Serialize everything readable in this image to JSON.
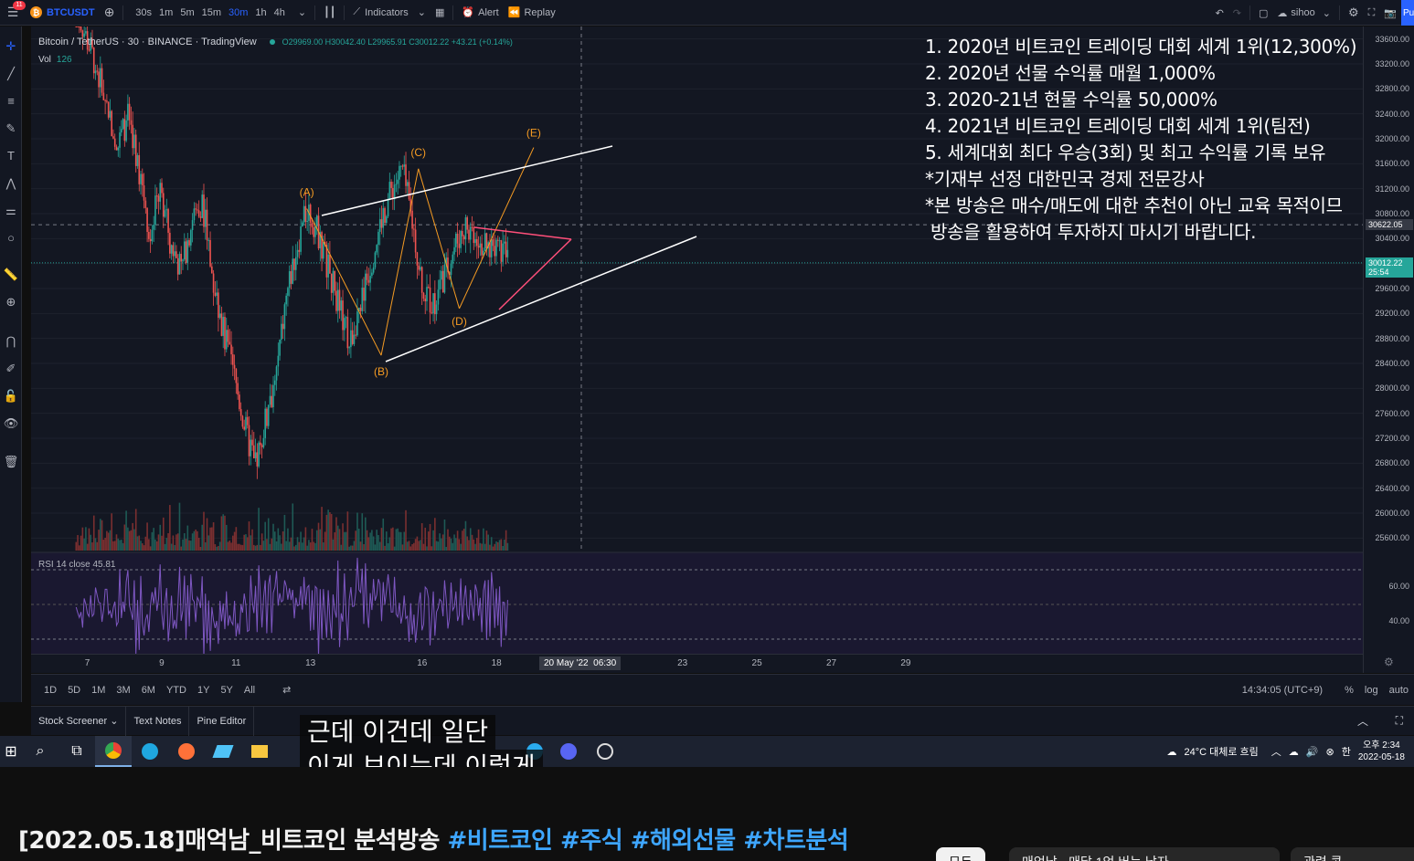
{
  "toolbar": {
    "notification_count": "11",
    "symbol": "BTCUSDT",
    "timeframes": [
      "30s",
      "1m",
      "5m",
      "15m",
      "30m",
      "1h",
      "4h"
    ],
    "active_timeframe": "30m",
    "indicators_label": "Indicators",
    "alert_label": "Alert",
    "replay_label": "Replay",
    "layout_name": "sihoo",
    "publish_label": "Pu"
  },
  "legend": {
    "title": "Bitcoin / TetherUS · 30 · BINANCE · TradingView",
    "ohlc": "O29969.00 H30042.40 L29965.91 C30012.22 +43.21 (+0.14%)",
    "vol_label": "Vol",
    "vol_value": "126",
    "rsi_label": "RSI 14 close 45.81"
  },
  "notes": [
    "1. 2020년 비트코인 트레이딩 대회 세계 1위(12,300%)",
    "2. 2020년 선물 수익률 매월 1,000%",
    "3. 2020-21년 현물 수익률 50,000%",
    "4. 2021년 비트코인 트레이딩 대회 세계 1위(팀전)",
    "5. 세계대회 최다 우승(3회) 및 최고 수익률 기록 보유",
    "*기재부 선정 대한민국 경제 전문강사",
    "*본 방송은 매수/매도에 대한 추천이 아닌 교육 목적이므",
    " 방송을 활용하여 투자하지 마시기 바랍니다."
  ],
  "chart_data": {
    "type": "line",
    "title": "Bitcoin / TetherUS · 30 · BINANCE",
    "ylim": [
      25400,
      33800
    ],
    "price_ticks": [
      33600,
      33200,
      32800,
      32400,
      32000,
      31600,
      31200,
      30800,
      30400,
      30000,
      29600,
      29200,
      28800,
      28400,
      28000,
      27600,
      27200,
      26800,
      26400,
      26000,
      25600
    ],
    "price_tick_labels": [
      "33600.00",
      "33200.00",
      "32800.00",
      "32400.00",
      "32000.00",
      "31600.00",
      "31200.00",
      "30800.00",
      "30400.00",
      "30000.00",
      "29600.00",
      "29200.00",
      "28800.00",
      "28400.00",
      "28000.00",
      "27600.00",
      "27200.00",
      "26800.00",
      "26400.00",
      "26000.00",
      "25600.00"
    ],
    "crosshair_price": "30622.05",
    "last_price": "30012.22",
    "countdown": "25:54",
    "wave_labels": [
      "(A)",
      "(B)",
      "(C)",
      "(D)",
      "(E)"
    ],
    "wave_points": [
      {
        "label": "(A)",
        "day": 12.9,
        "price": 30880
      },
      {
        "label": "(B)",
        "day": 14.9,
        "price": 28530
      },
      {
        "label": "(C)",
        "day": 15.9,
        "price": 31520
      },
      {
        "label": "(D)",
        "day": 17.0,
        "price": 29280
      },
      {
        "label": "(E)",
        "day": 19.0,
        "price": 31860
      }
    ],
    "series": [
      {
        "values": [
          34100,
          33600,
          33100,
          32500,
          31900,
          32400,
          31500,
          30500,
          31200,
          30300,
          29900,
          30700,
          31000,
          29700,
          28900,
          28200,
          27400,
          26700,
          27500,
          28200,
          29500,
          30300,
          30900,
          30500,
          29900,
          29300,
          28700,
          29400,
          30000,
          30700,
          31200,
          31500,
          30600,
          29600,
          29300,
          29800,
          30300,
          30600,
          30500,
          30200,
          30400,
          30000
        ]
      }
    ],
    "x_day_start": 6.7,
    "x_day_end": 18.3,
    "rsi_ticks": [
      "60.00",
      "40.00"
    ],
    "x_tick_labels": [
      "7",
      "9",
      "11",
      "13",
      "16",
      "18",
      "20 May '22  06:30",
      "23",
      "25",
      "27",
      "29"
    ]
  },
  "rangebar": {
    "ranges": [
      "1D",
      "5D",
      "1M",
      "3M",
      "6M",
      "YTD",
      "1Y",
      "5Y",
      "All"
    ],
    "time": "14:34:05 (UTC+9)",
    "percent": "%",
    "log": "log",
    "auto": "auto"
  },
  "panels": [
    "Stock Screener",
    "Text Notes",
    "Pine Editor"
  ],
  "taskbar": {
    "weather": "24°C  대체로 흐림",
    "time": "오후 2:34",
    "date": "2022-05-18"
  },
  "subtitles": [
    "근데 이건데 일단",
    "이게 보이는데 이렇게"
  ],
  "youtube": {
    "title_main": "[2022.05.18]매억남_비트코인 분석방송 ",
    "tags": [
      "#비트코인",
      "#주식",
      "#해외선물",
      "#차트분석"
    ],
    "chips": [
      "모두",
      "매억남 - 매달 1억 버는 남자",
      "관련 콘"
    ]
  },
  "colors": {
    "background": "#131722",
    "up": "#26a69a",
    "down": "#ef5350",
    "accent": "#2962ff",
    "wave": "#f59b23",
    "rsi": "#7e57c2",
    "pink": "#ff4f7a"
  }
}
